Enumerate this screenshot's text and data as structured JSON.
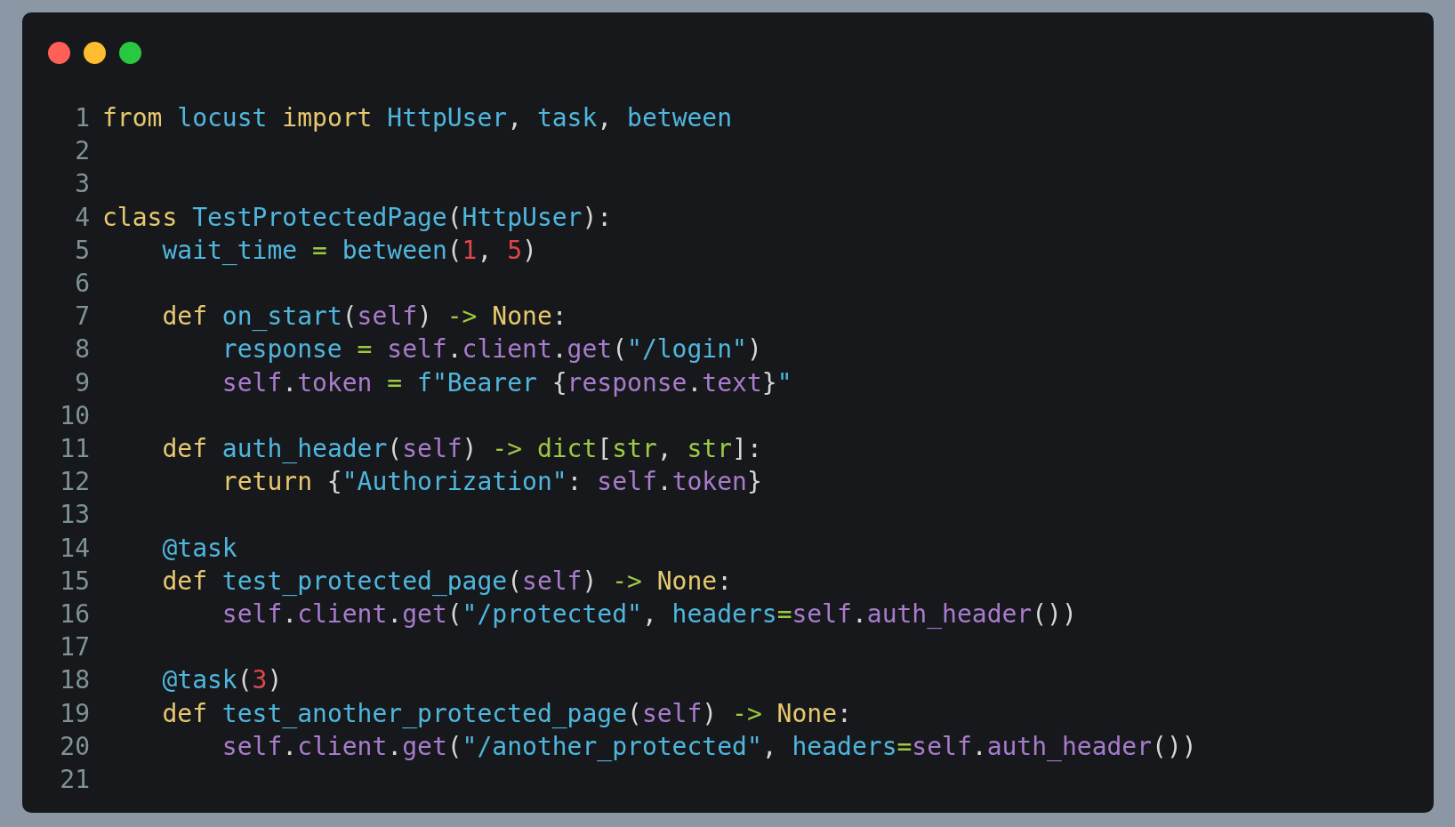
{
  "window": {
    "controls": [
      {
        "kind": "close"
      },
      {
        "kind": "minimize"
      },
      {
        "kind": "zoom"
      }
    ]
  },
  "code": {
    "lines": [
      {
        "number": "1",
        "tokens": [
          {
            "kind": "kw",
            "text": "from"
          },
          {
            "kind": "id",
            "text": " locust"
          },
          {
            "kind": "kw",
            "text": " import"
          },
          {
            "kind": "id",
            "text": " HttpUser"
          },
          {
            "kind": "p",
            "text": ","
          },
          {
            "kind": "id",
            "text": " task"
          },
          {
            "kind": "p",
            "text": ","
          },
          {
            "kind": "id",
            "text": " between"
          }
        ]
      },
      {
        "number": "2"
      },
      {
        "number": "3"
      },
      {
        "number": "4",
        "tokens": [
          {
            "kind": "kw",
            "text": "class"
          },
          {
            "kind": "id",
            "text": " TestProtectedPage"
          },
          {
            "kind": "p",
            "text": "("
          },
          {
            "kind": "id",
            "text": "HttpUser"
          },
          {
            "kind": "p",
            "text": "):"
          }
        ]
      },
      {
        "number": "5",
        "tokens": [
          {
            "kind": "id",
            "text": "    wait_time"
          },
          {
            "kind": "op",
            "text": " ="
          },
          {
            "kind": "id",
            "text": " between"
          },
          {
            "kind": "p",
            "text": "("
          },
          {
            "kind": "num",
            "text": "1"
          },
          {
            "kind": "p",
            "text": ","
          },
          {
            "kind": "num",
            "text": " 5"
          },
          {
            "kind": "p",
            "text": ")"
          }
        ]
      },
      {
        "number": "6"
      },
      {
        "number": "7",
        "tokens": [
          {
            "kind": "kw",
            "text": "    def"
          },
          {
            "kind": "id",
            "text": " on_start"
          },
          {
            "kind": "p",
            "text": "("
          },
          {
            "kind": "self",
            "text": "self"
          },
          {
            "kind": "p",
            "text": ")"
          },
          {
            "kind": "op",
            "text": " ->"
          },
          {
            "kind": "kw",
            "text": " None"
          },
          {
            "kind": "p",
            "text": ":"
          }
        ]
      },
      {
        "number": "8",
        "tokens": [
          {
            "kind": "id",
            "text": "        response"
          },
          {
            "kind": "op",
            "text": " ="
          },
          {
            "kind": "self",
            "text": " self"
          },
          {
            "kind": "p",
            "text": "."
          },
          {
            "kind": "self",
            "text": "client"
          },
          {
            "kind": "p",
            "text": "."
          },
          {
            "kind": "self",
            "text": "get"
          },
          {
            "kind": "p",
            "text": "("
          },
          {
            "kind": "str",
            "text": "\"/login\""
          },
          {
            "kind": "p",
            "text": ")"
          }
        ]
      },
      {
        "number": "9",
        "tokens": [
          {
            "kind": "self",
            "text": "        self"
          },
          {
            "kind": "p",
            "text": "."
          },
          {
            "kind": "self",
            "text": "token"
          },
          {
            "kind": "op",
            "text": " ="
          },
          {
            "kind": "str",
            "text": " f\"Bearer"
          },
          {
            "kind": "p",
            "text": " {"
          },
          {
            "kind": "self",
            "text": "response"
          },
          {
            "kind": "p",
            "text": "."
          },
          {
            "kind": "self",
            "text": "text"
          },
          {
            "kind": "p",
            "text": "}"
          },
          {
            "kind": "str",
            "text": "\""
          }
        ]
      },
      {
        "number": "10"
      },
      {
        "number": "11",
        "tokens": [
          {
            "kind": "kw",
            "text": "    def"
          },
          {
            "kind": "id",
            "text": " auth_header"
          },
          {
            "kind": "p",
            "text": "("
          },
          {
            "kind": "self",
            "text": "self"
          },
          {
            "kind": "p",
            "text": ")"
          },
          {
            "kind": "op",
            "text": " ->"
          },
          {
            "kind": "type",
            "text": " dict"
          },
          {
            "kind": "p",
            "text": "["
          },
          {
            "kind": "type",
            "text": "str"
          },
          {
            "kind": "p",
            "text": ","
          },
          {
            "kind": "type",
            "text": " str"
          },
          {
            "kind": "p",
            "text": "]:"
          }
        ]
      },
      {
        "number": "12",
        "tokens": [
          {
            "kind": "kw",
            "text": "        return"
          },
          {
            "kind": "p",
            "text": " {"
          },
          {
            "kind": "str",
            "text": "\"Authorization\""
          },
          {
            "kind": "p",
            "text": ":"
          },
          {
            "kind": "self",
            "text": " self"
          },
          {
            "kind": "p",
            "text": "."
          },
          {
            "kind": "self",
            "text": "token"
          },
          {
            "kind": "p",
            "text": "}"
          }
        ]
      },
      {
        "number": "13"
      },
      {
        "number": "14",
        "tokens": [
          {
            "kind": "id",
            "text": "    @task"
          }
        ]
      },
      {
        "number": "15",
        "tokens": [
          {
            "kind": "kw",
            "text": "    def"
          },
          {
            "kind": "id",
            "text": " test_protected_page"
          },
          {
            "kind": "p",
            "text": "("
          },
          {
            "kind": "self",
            "text": "self"
          },
          {
            "kind": "p",
            "text": ")"
          },
          {
            "kind": "op",
            "text": " ->"
          },
          {
            "kind": "kw",
            "text": " None"
          },
          {
            "kind": "p",
            "text": ":"
          }
        ]
      },
      {
        "number": "16",
        "tokens": [
          {
            "kind": "self",
            "text": "        self"
          },
          {
            "kind": "p",
            "text": "."
          },
          {
            "kind": "self",
            "text": "client"
          },
          {
            "kind": "p",
            "text": "."
          },
          {
            "kind": "self",
            "text": "get"
          },
          {
            "kind": "p",
            "text": "("
          },
          {
            "kind": "str",
            "text": "\"/protected\""
          },
          {
            "kind": "p",
            "text": ","
          },
          {
            "kind": "id",
            "text": " headers"
          },
          {
            "kind": "op",
            "text": "="
          },
          {
            "kind": "self",
            "text": "self"
          },
          {
            "kind": "p",
            "text": "."
          },
          {
            "kind": "self",
            "text": "auth_header"
          },
          {
            "kind": "p",
            "text": "())"
          }
        ]
      },
      {
        "number": "17"
      },
      {
        "number": "18",
        "tokens": [
          {
            "kind": "id",
            "text": "    @task"
          },
          {
            "kind": "p",
            "text": "("
          },
          {
            "kind": "num",
            "text": "3"
          },
          {
            "kind": "p",
            "text": ")"
          }
        ]
      },
      {
        "number": "19",
        "tokens": [
          {
            "kind": "kw",
            "text": "    def"
          },
          {
            "kind": "id",
            "text": " test_another_protected_page"
          },
          {
            "kind": "p",
            "text": "("
          },
          {
            "kind": "self",
            "text": "self"
          },
          {
            "kind": "p",
            "text": ")"
          },
          {
            "kind": "op",
            "text": " ->"
          },
          {
            "kind": "kw",
            "text": " None"
          },
          {
            "kind": "p",
            "text": ":"
          }
        ]
      },
      {
        "number": "20",
        "tokens": [
          {
            "kind": "self",
            "text": "        self"
          },
          {
            "kind": "p",
            "text": "."
          },
          {
            "kind": "self",
            "text": "client"
          },
          {
            "kind": "p",
            "text": "."
          },
          {
            "kind": "self",
            "text": "get"
          },
          {
            "kind": "p",
            "text": "("
          },
          {
            "kind": "str",
            "text": "\"/another_protected\""
          },
          {
            "kind": "p",
            "text": ","
          },
          {
            "kind": "id",
            "text": " headers"
          },
          {
            "kind": "op",
            "text": "="
          },
          {
            "kind": "self",
            "text": "self"
          },
          {
            "kind": "p",
            "text": "."
          },
          {
            "kind": "self",
            "text": "auth_header"
          },
          {
            "kind": "p",
            "text": "())"
          }
        ]
      },
      {
        "number": "21"
      }
    ]
  }
}
